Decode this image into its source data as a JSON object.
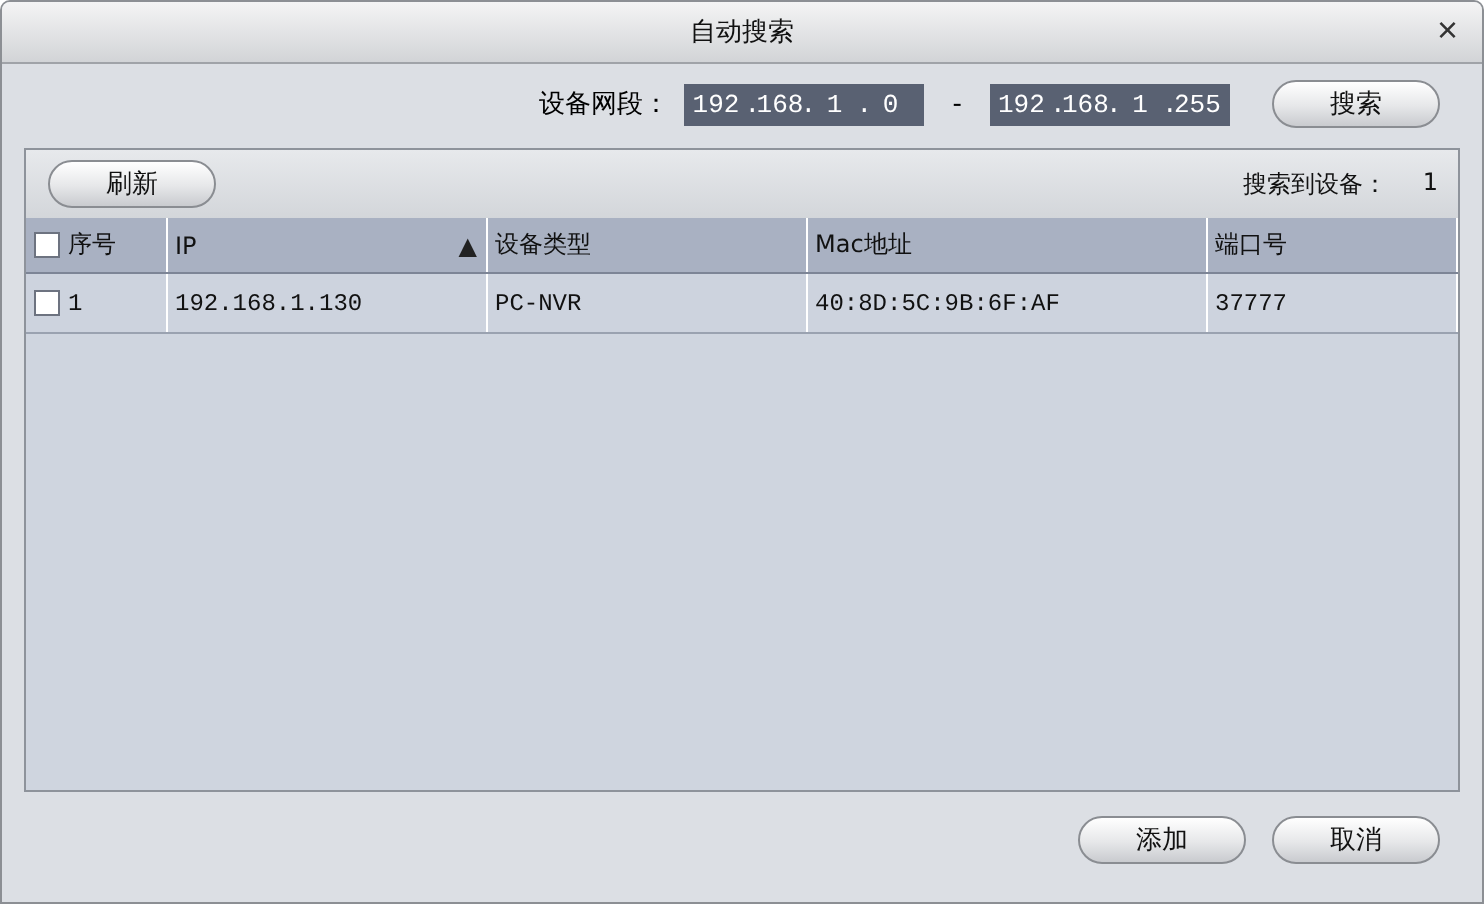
{
  "window": {
    "title": "自动搜索",
    "close": "×"
  },
  "range": {
    "label": "设备网段：",
    "separator": ".",
    "dash": "-",
    "from": [
      "192",
      "168",
      "1",
      "0"
    ],
    "to": [
      "192",
      "168",
      "1",
      "255"
    ],
    "button": "搜索"
  },
  "toolbar": {
    "refresh": "刷新",
    "found_label": "搜索到设备：",
    "found_count": "1"
  },
  "table": {
    "select_all": {
      "checked": false
    },
    "columns": [
      {
        "label": "序号"
      },
      {
        "label": "IP",
        "sort": "▲"
      },
      {
        "label": "设备类型"
      },
      {
        "label": "Mac地址"
      },
      {
        "label": "端口号"
      }
    ],
    "rows": [
      {
        "checked": false,
        "cells": [
          "1",
          "192.168.1.130",
          "PC-NVR",
          "40:8D:5C:9B:6F:AF",
          "37777"
        ]
      }
    ]
  },
  "buttons": [
    "添加",
    "取消"
  ]
}
